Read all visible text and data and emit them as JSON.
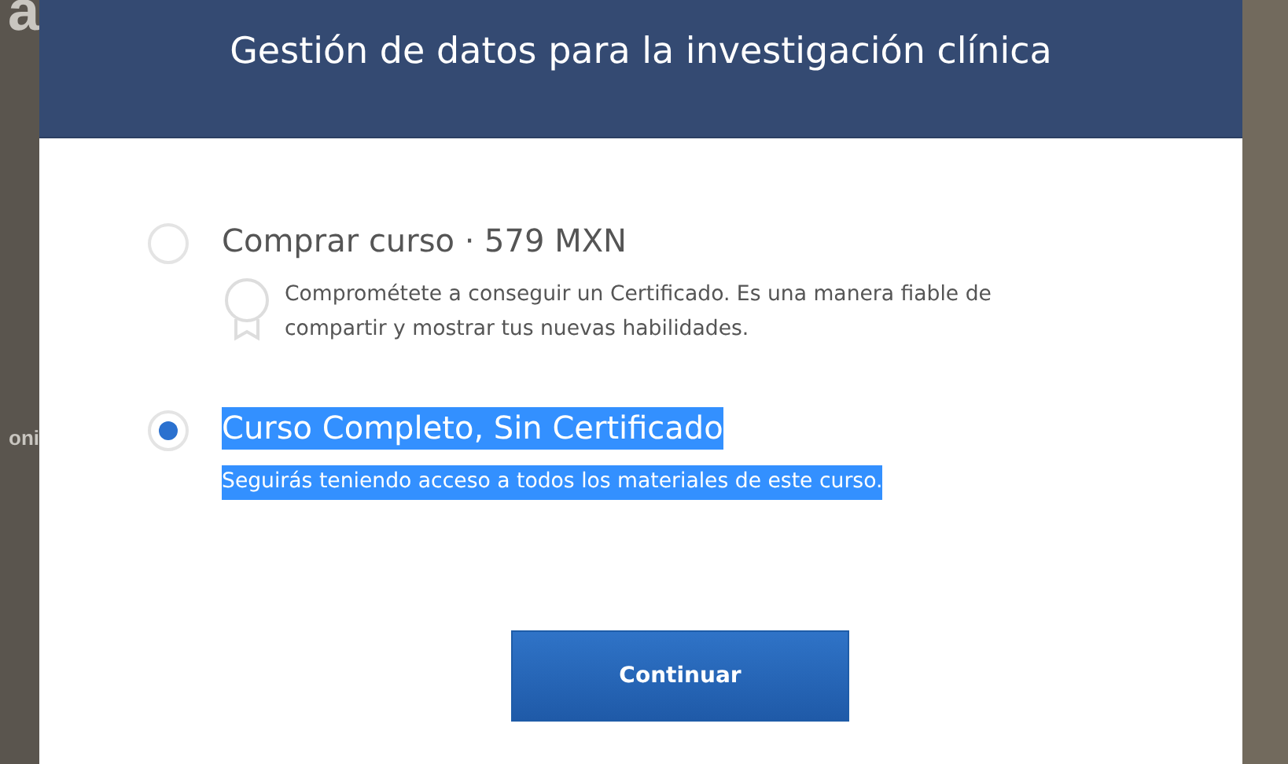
{
  "backdrop": {
    "texts": [
      "a",
      "oni"
    ]
  },
  "dialog": {
    "title": "Gestión de datos para la investigación clínica",
    "options": [
      {
        "kind": "purchase",
        "label": "Comprar curso · 579 MXN",
        "description": "Comprométete a conseguir un Certificado. Es una manera fiable de compartir y mostrar tus nuevas habilidades.",
        "selected": false,
        "highlighted": false
      },
      {
        "kind": "audit",
        "label": "Curso Completo, Sin Certificado",
        "description": "Seguirás teniendo acceso a todos los materiales de este curso.",
        "selected": true,
        "highlighted": true
      }
    ],
    "button": "Continuar"
  }
}
